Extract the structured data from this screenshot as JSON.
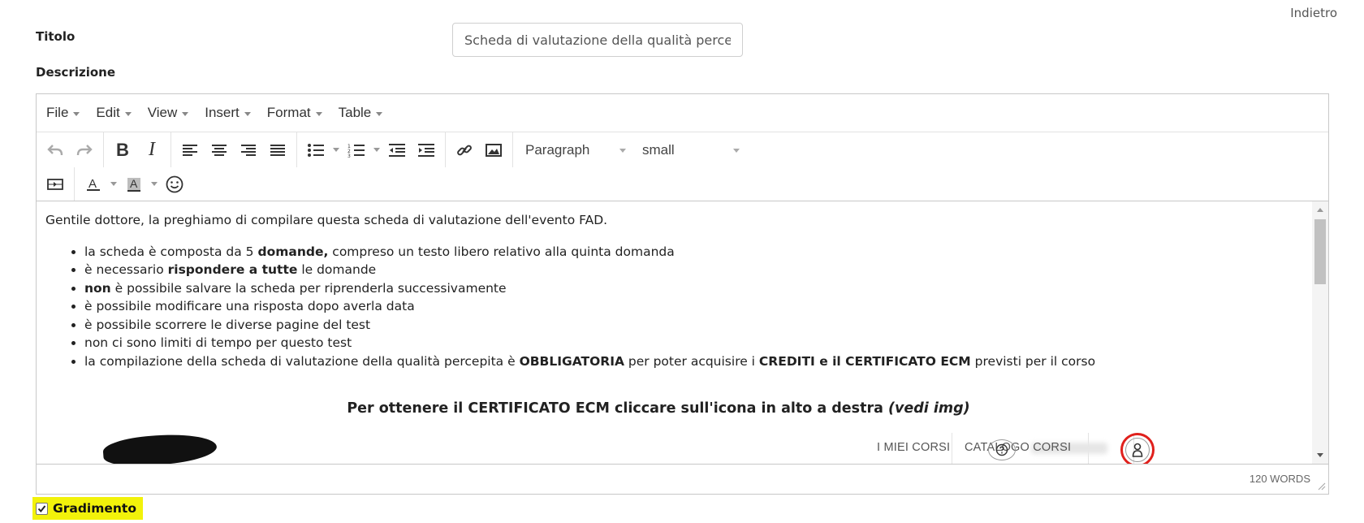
{
  "header": {
    "back_link": "Indietro"
  },
  "form": {
    "title_label": "Titolo",
    "title_value": "Scheda di valutazione della qualità percepita",
    "description_label": "Descrizione"
  },
  "editor": {
    "menu": [
      "File",
      "Edit",
      "View",
      "Insert",
      "Format",
      "Table"
    ],
    "paragraph_select": "Paragraph",
    "size_select": "small",
    "word_count": "120 WORDS"
  },
  "content": {
    "intro": "Gentile dottore, la preghiamo di compilare questa scheda di valutazione dell'evento FAD.",
    "bullets": [
      [
        {
          "t": "la scheda è composta da 5 "
        },
        {
          "t": "domande,",
          "b": true
        },
        {
          "t": " compreso un testo libero relativo alla quinta domanda"
        }
      ],
      [
        {
          "t": "è necessario "
        },
        {
          "t": "rispondere a tutte",
          "b": true
        },
        {
          "t": " le domande"
        }
      ],
      [
        {
          "t": "non",
          "b": true
        },
        {
          "t": " è possibile salvare la scheda per riprenderla successivamente"
        }
      ],
      [
        {
          "t": "è possibile modificare una risposta dopo averla data"
        }
      ],
      [
        {
          "t": "è possibile scorrere le diverse pagine del test"
        }
      ],
      [
        {
          "t": "non ci sono limiti di tempo per questo test"
        }
      ],
      [
        {
          "t": "la compilazione della scheda di valutazione della qualità percepita è "
        },
        {
          "t": "OBBLIGATORIA",
          "b": true
        },
        {
          "t": " per poter acquisire i "
        },
        {
          "t": "CREDITI e il CERTIFICATO ECM",
          "b": true
        },
        {
          "t": " previsti per il corso"
        }
      ]
    ],
    "cert_text": "Per ottenere il CERTIFICATO ECM cliccare sull'icona in alto a destra ",
    "cert_italic": "(vedi img)",
    "embed_nav": {
      "my_courses": "I MIEI CORSI",
      "catalog": "CATALOGO CORSI"
    }
  },
  "gradimento": {
    "label": "Gradimento",
    "checked": true
  }
}
